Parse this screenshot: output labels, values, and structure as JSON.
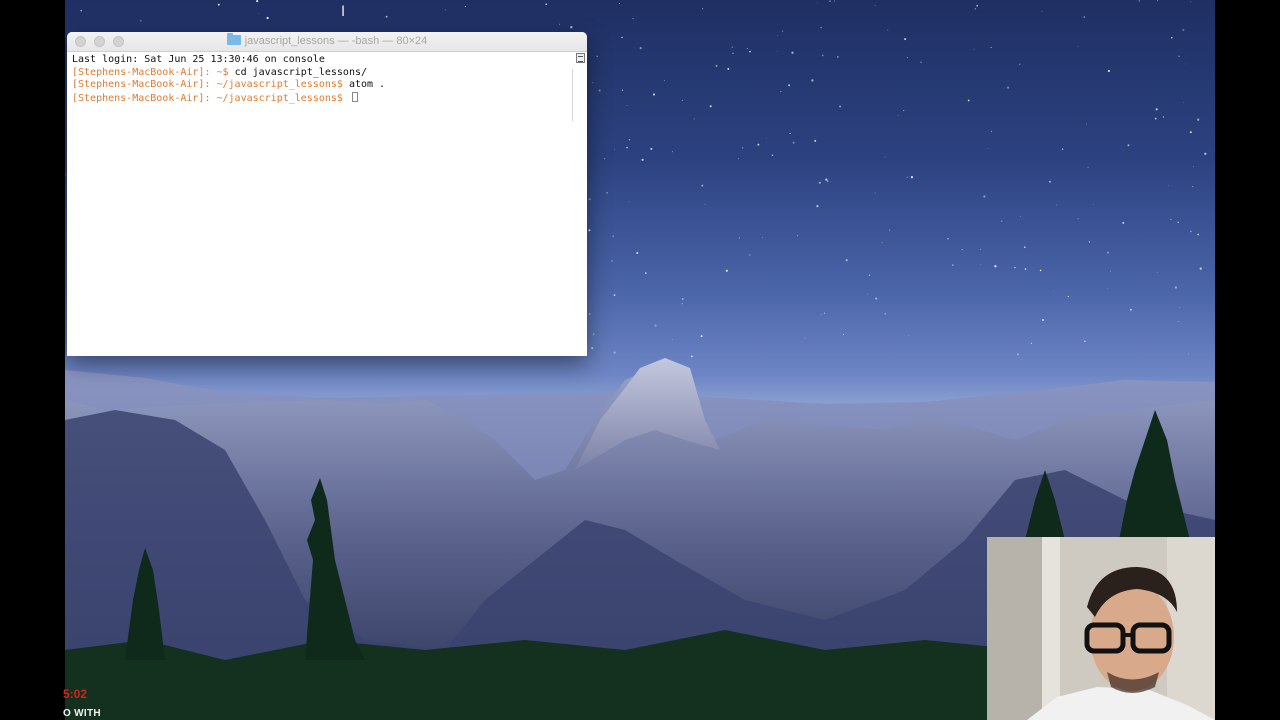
{
  "terminal": {
    "title": "javascript_lessons — -bash — 80×24",
    "lines": [
      {
        "prompt": "",
        "text": "Last login: Sat Jun 25 13:30:46 on console"
      },
      {
        "prompt": "[Stephens-MacBook-Air]: ~$",
        "text": " cd javascript_lessons/"
      },
      {
        "prompt": "[Stephens-MacBook-Air]: ~/javascript_lessons$",
        "text": " atom ."
      },
      {
        "prompt": "[Stephens-MacBook-Air]: ~/javascript_lessons$",
        "text": " "
      }
    ]
  },
  "overlay": {
    "time_fragment": "5:02",
    "caption_fragment": "O WITH"
  },
  "colors": {
    "prompt": "#e07a2f",
    "sky_top": "#1f2f63",
    "overlay_red": "#d1231b"
  }
}
